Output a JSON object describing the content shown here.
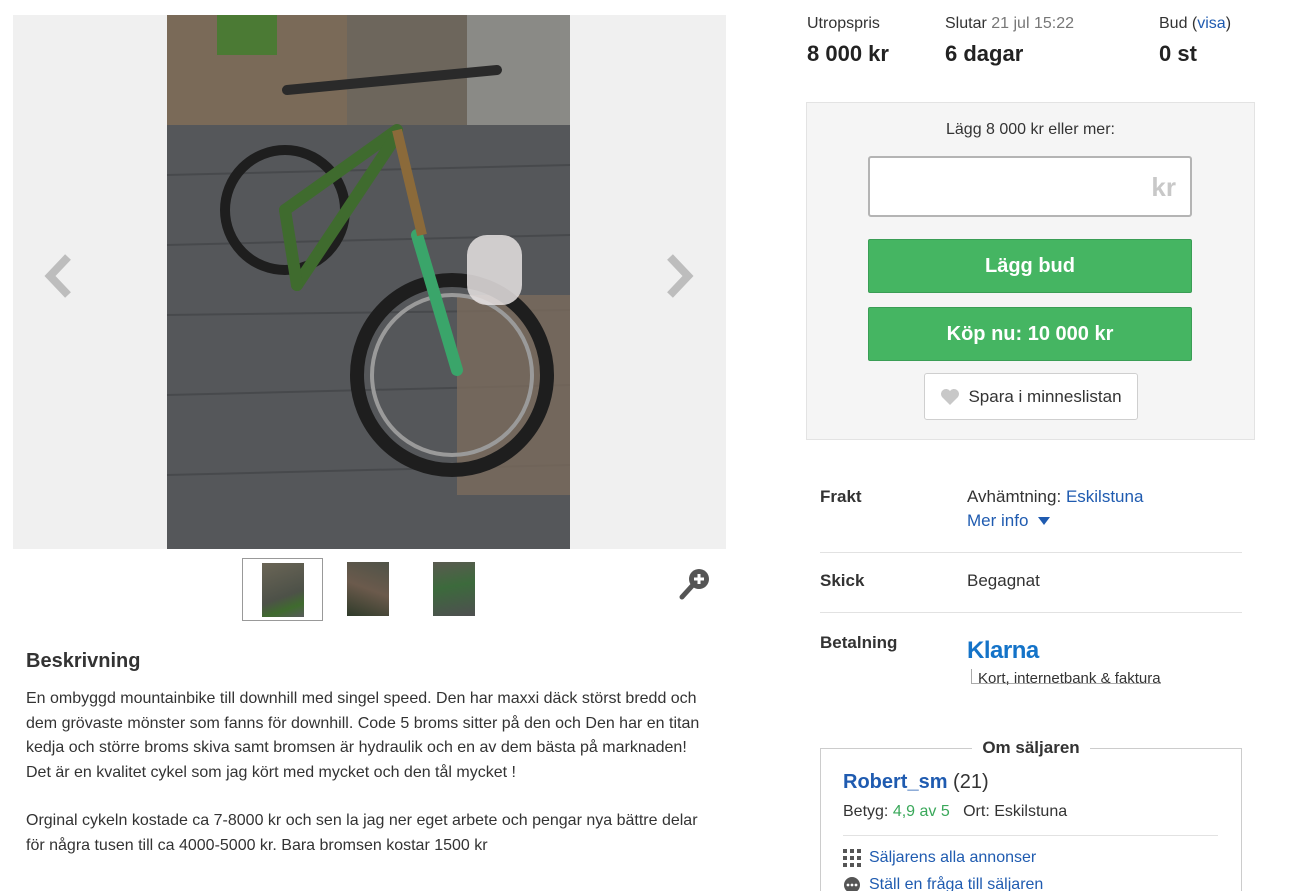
{
  "stats": {
    "start_price_label": "Utropspris",
    "start_price": "8 000 kr",
    "ends_label": "Slutar",
    "ends_date": "21 jul 15:22",
    "ends_value": "6 dagar",
    "bids_label": "Bud",
    "bids_link": "visa",
    "bids_value": "0 st"
  },
  "bid": {
    "hint": "Lägg 8 000 kr eller mer:",
    "input_value": "",
    "currency": "kr",
    "place_bid": "Lägg bud",
    "buy_now": "Köp nu: 10 000 kr",
    "save": "Spara i minneslistan"
  },
  "info": {
    "shipping_label": "Frakt",
    "shipping_value": "Avhämtning:",
    "shipping_city": "Eskilstuna",
    "more_info": "Mer info",
    "condition_label": "Skick",
    "condition_value": "Begagnat",
    "payment_label": "Betalning",
    "payment_brand": "Klarna",
    "payment_methods": "Kort, internetbank & faktura"
  },
  "seller": {
    "legend": "Om säljaren",
    "name": "Robert_sm",
    "count": "(21)",
    "rating_label": "Betyg:",
    "rating": "4,9 av 5",
    "location_label": "Ort: Eskilstuna",
    "all_ads": "Säljarens alla annonser",
    "ask": "Ställ en fråga till säljaren"
  },
  "description": {
    "heading": "Beskrivning",
    "p1": "En ombyggd mountainbike till downhill med singel speed. Den har maxxi däck störst bredd och dem grövaste mönster som fanns för downhill. Code 5 broms sitter på den och Den har en titan kedja och större broms skiva samt bromsen är hydraulik och en av dem bästa på marknaden! Det är en kvalitet cykel som jag kört med mycket och den tål mycket !",
    "p2": "Orginal cykeln kostade ca 7-8000 kr och sen la jag ner eget arbete och pengar nya bättre delar för några tusen till ca 4000-5000 kr. Bara bromsen kostar 1500 kr"
  },
  "colors": {
    "accent_green": "#45b562",
    "link_blue": "#1f5bb0",
    "klarna_blue": "#1473c8"
  }
}
